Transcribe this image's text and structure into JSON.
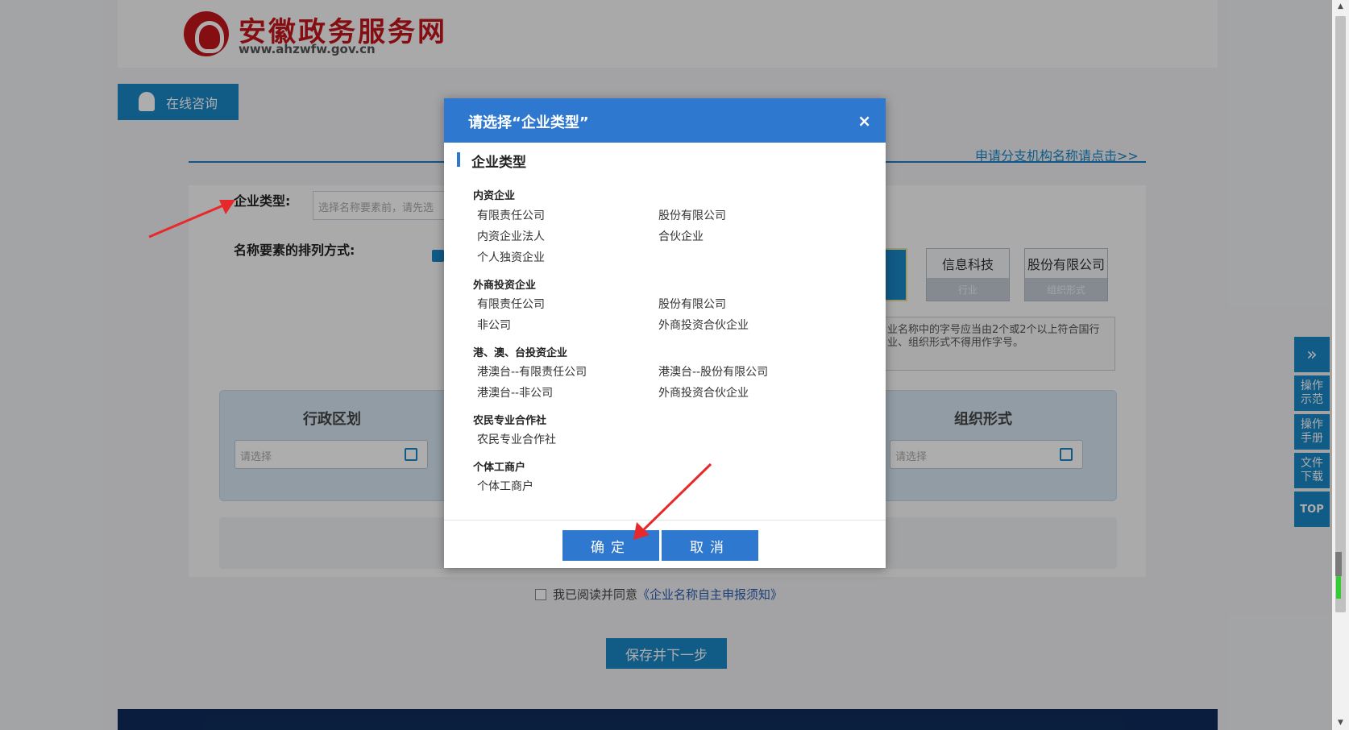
{
  "site": {
    "title": "安徽政务服务网",
    "url": "www.ahzwfw.gov.cn"
  },
  "consult": {
    "label": "在线咨询"
  },
  "branch_link": "申请分支机构名称请点击>>",
  "form": {
    "type_label": "企业类型:",
    "type_placeholder": "选择名称要素前，请先选",
    "order_label": "名称要素的排列方式:",
    "elements": [
      {
        "title": "信息科技",
        "sub": "行业"
      },
      {
        "title": "股份有限公司",
        "sub": "组织形式"
      }
    ],
    "hint": "业名称中的字号应当由2个或2个以上符合国行业、组织形式不得用作字号。",
    "panel": {
      "left_title": "行政区划",
      "right_title": "组织形式",
      "left_placeholder": "请选择",
      "right_placeholder": "请选择"
    },
    "agree_text": "我已阅读并同意",
    "agree_link": "《企业名称自主申报须知》",
    "save_label": "保存并下一步"
  },
  "side_tools": [
    "»",
    "操作示范",
    "操作手册",
    "文件下载",
    "TOP"
  ],
  "modal": {
    "title": "请选择“企业类型”",
    "close": "×",
    "section": "企业类型",
    "groups": [
      {
        "title": "内资企业",
        "options": [
          "有限责任公司",
          "股份有限公司",
          "内资企业法人",
          "合伙企业",
          "个人独资企业"
        ]
      },
      {
        "title": "外商投资企业",
        "options": [
          "有限责任公司",
          "股份有限公司",
          "非公司",
          "外商投资合伙企业"
        ]
      },
      {
        "title": "港、澳、台投资企业",
        "options": [
          "港澳台--有限责任公司",
          "港澳台--股份有限公司",
          "港澳台--非公司",
          "外商投资合伙企业"
        ]
      },
      {
        "title": "农民专业合作社",
        "options": [
          "农民专业合作社"
        ]
      },
      {
        "title": "个体工商户",
        "options": [
          "个体工商户"
        ]
      }
    ],
    "confirm": "确定",
    "cancel": "取消"
  },
  "colors": {
    "primary": "#2f78cf",
    "site_blue": "#1a86c8",
    "brand_red": "#c4161c",
    "annotation": "#e8292b"
  }
}
